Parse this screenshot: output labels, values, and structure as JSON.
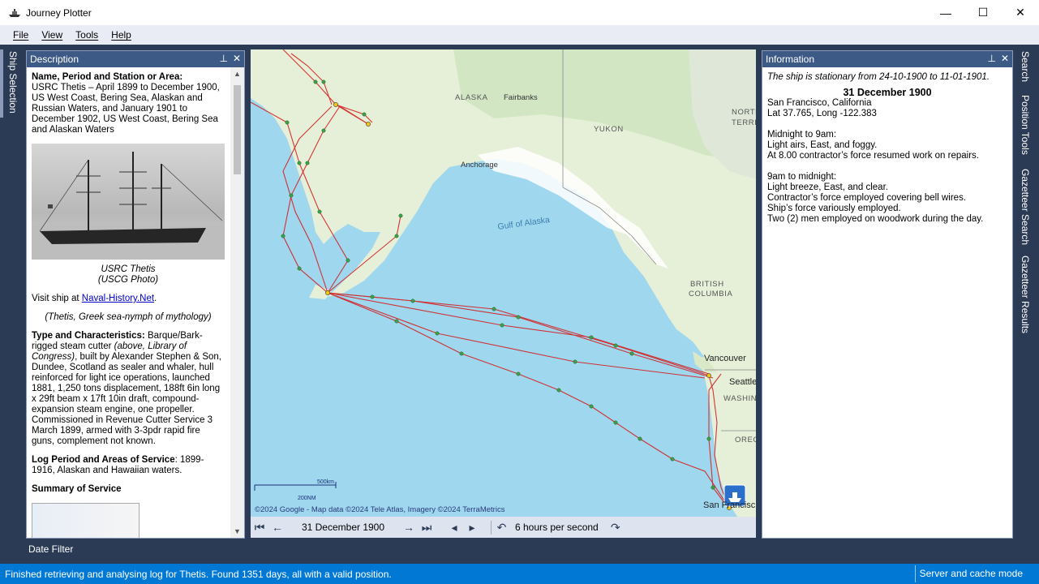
{
  "window": {
    "title": "Journey Plotter",
    "controls": [
      "—",
      "☐",
      "✕"
    ]
  },
  "menu": [
    "File",
    "View",
    "Tools",
    "Help"
  ],
  "left_tabs": [
    "Ship Selection"
  ],
  "right_tabs": [
    "Search",
    "Position Tools",
    "Gazetteer Search",
    "Gazetteer Results"
  ],
  "description": {
    "header": "Description",
    "name_heading": "Name, Period and Station or Area:",
    "name_text": "USRC Thetis – April 1899 to December 1900, US West Coast, Bering Sea, Alaskan and Russian Waters, and January 1901 to December 1902, US West Coast, Bering Sea and Alaskan Waters",
    "photo_caption_1": "USRC Thetis",
    "photo_caption_2": "(USCG Photo)",
    "visit_prefix": "Visit ship at ",
    "visit_link": "Naval-History.Net",
    "visit_suffix": ".",
    "greek_note": "(Thetis, Greek sea-nymph of mythology)",
    "type_heading": "Type and Characteristics:",
    "type_text_1": " Barque/Bark-rigged steam cutter ",
    "type_italic": "(above, Library of Congress)",
    "type_text_2": ", built by Alexander Stephen & Son, Dundee, Scotland as sealer and whaler, hull reinforced for light ice operations, launched 1881, 1,250 tons displacement, 188ft 6in long x 29ft beam x 17ft 10in draft, compound-expansion steam engine, one propeller. Commissioned in Revenue Cutter Service 3 March 1899, armed with 3-3pdr rapid fire guns, complement not known.",
    "log_heading": "Log Period and Areas of Service",
    "log_text": ": 1899-1916, Alaskan and Hawaiian waters.",
    "summary_heading": "Summary of Service"
  },
  "map": {
    "labels": [
      "ALASKA",
      "Fairbanks",
      "YUKON",
      "NORTH\nTERRIT",
      "Anchorage",
      "Gulf of Alaska",
      "BRITISH\nCOLUMBIA",
      "Vancouver",
      "Seattle",
      "WASHIN",
      "OREG",
      "San Francisc"
    ],
    "scale_km": "500km",
    "scale_nm": "200NM",
    "attribution": "©2024 Google - Map data ©2024 Tele Atlas, Imagery ©2024 TerraMetrics"
  },
  "toolbar": {
    "date": "31 December 1900",
    "speed": "6 hours per second"
  },
  "information": {
    "header": "Information",
    "stationary": "The ship is stationary from 24-10-1900 to 11-01-1901.",
    "date": "31 December 1900",
    "place": "San Francisco, California",
    "latlong": "Lat 37.765, Long -122.383",
    "p1_title": "Midnight to 9am:",
    "p1_l1": "Light airs, East, and foggy.",
    "p1_l2": "At 8.00 contractor’s force resumed work on repairs.",
    "p2_title": "9am to midnight:",
    "p2_l1": "Light breeze, East, and clear.",
    "p2_l2": "Contractor’s force employed covering bell wires.",
    "p2_l3": "Ship’s force variously employed.",
    "p2_l4": "Two (2) men employed on woodwork during the day."
  },
  "date_filter": "Date Filter",
  "status": {
    "message": "Finished retrieving and analysing log for Thetis. Found 1351 days, all with a valid position.",
    "mode": "Server and cache mode"
  },
  "colors": {
    "header": "#3d5a87",
    "frame": "#2b3a55",
    "status": "#0078d4",
    "track": "#d42020"
  }
}
